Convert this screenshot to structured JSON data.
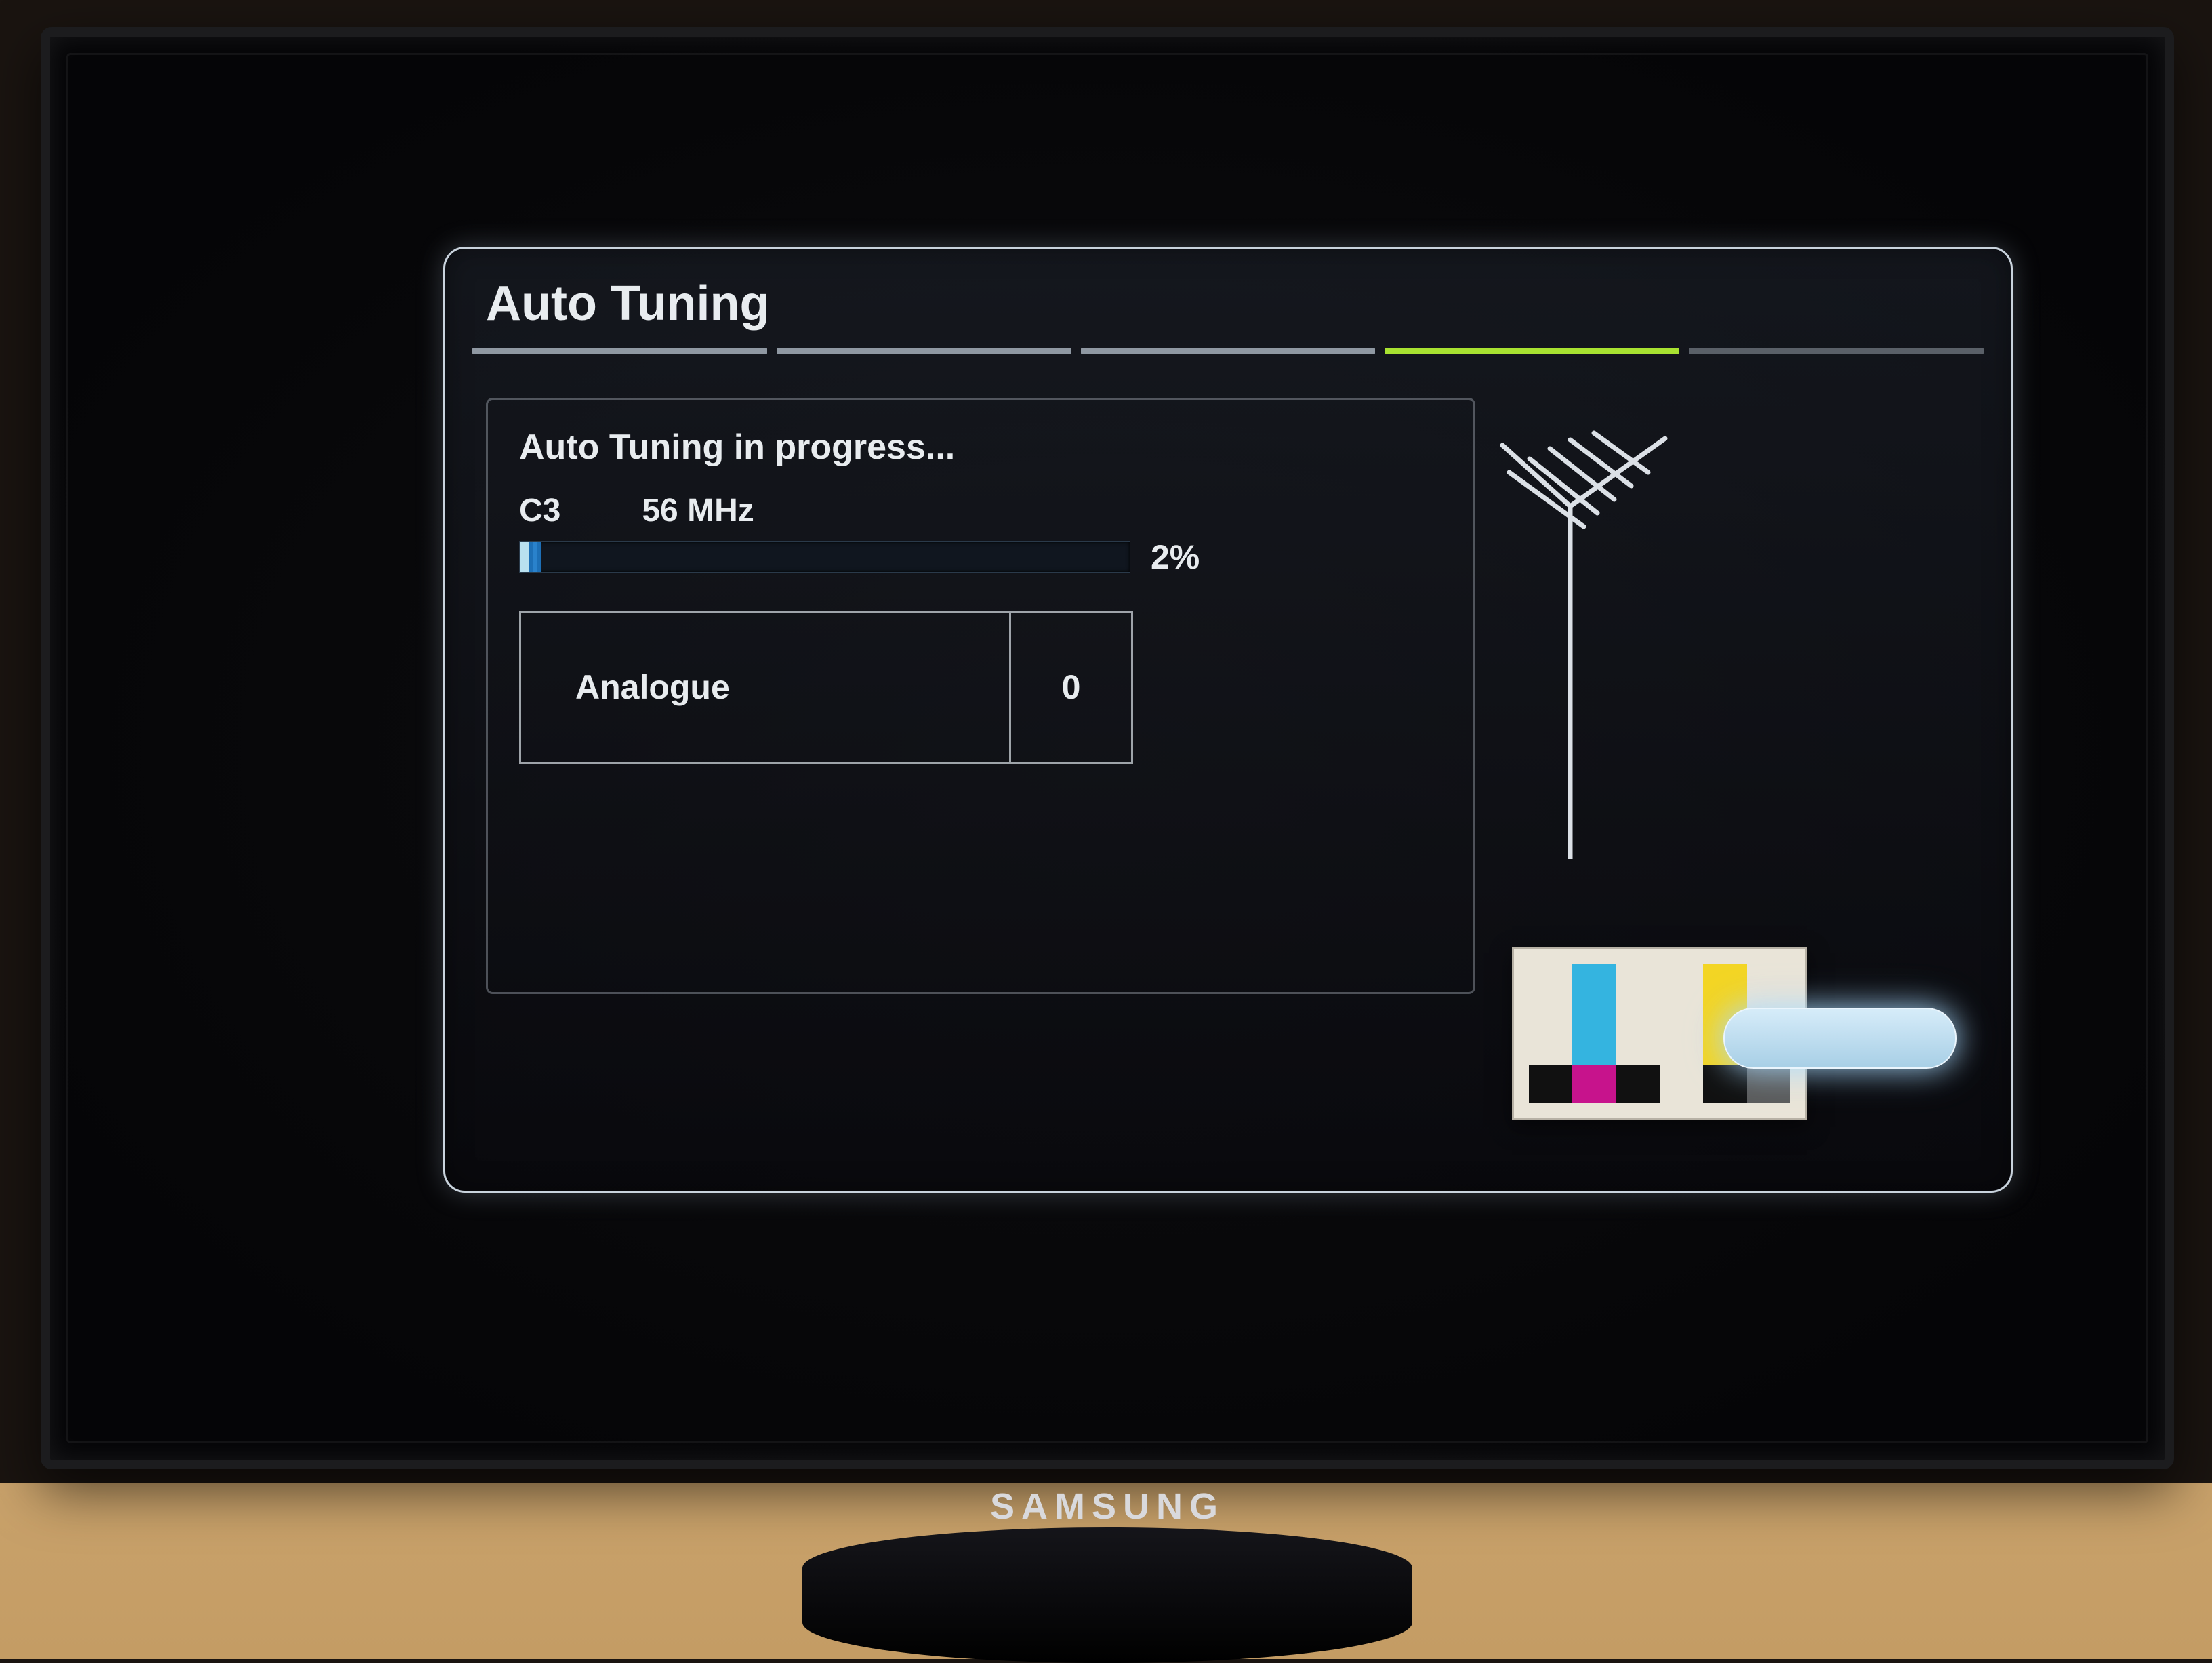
{
  "brand": "SAMSUNG",
  "dialog": {
    "title": "Auto Tuning",
    "tab_count": 5,
    "active_tab_index": 3
  },
  "status": {
    "message": "Auto Tuning in progress...",
    "channel": "C3",
    "frequency": "56 MHz",
    "percent_label": "2%",
    "percent_value": 2
  },
  "results": {
    "label": "Analogue",
    "count": "0"
  },
  "action": {
    "stop_label": ""
  },
  "icons": {
    "antenna": "antenna-icon",
    "tv_illustration": "tv-testcard-icon"
  },
  "colors": {
    "accent_green": "#a8e231",
    "progress_blue": "#2a82cc",
    "button_glow": "#a8cfe6"
  }
}
